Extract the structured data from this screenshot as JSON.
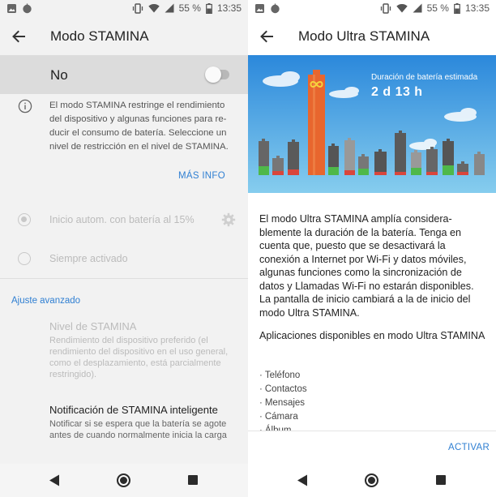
{
  "statusbar": {
    "battery": "55 %",
    "time": "13:35"
  },
  "left": {
    "title": "Modo STAMINA",
    "switch_label": "No",
    "switch_on": false,
    "description": "El modo STAMINA restringe el rendimiento del dispositivo y algunas funciones para re-ducir el consumo de batería. Seleccione un nivel de restricción en el nivel de STAMINA.",
    "more_info": "MÁS INFO",
    "options": [
      {
        "label": "Inicio autom. con batería al 15%",
        "selected": true
      },
      {
        "label": "Siempre activado",
        "selected": false
      }
    ],
    "advanced_header": "Ajuste avanzado",
    "stamina_level": {
      "title": "Nivel de STAMINA",
      "subtitle": "Rendimiento del dispositivo preferido (el rendimiento del dispositivo en el uso general, como el desplazamiento, está parcialmente restringido)."
    },
    "smart_notification": {
      "title": "Notificación de STAMINA inteligente",
      "subtitle": "Notificar si se espera que la batería se agote antes de cuando normalmente inicia la carga"
    }
  },
  "right": {
    "title": "Modo Ultra STAMINA",
    "battery_label": "Duración de batería estimada",
    "battery_value": "2 d 13 h",
    "description": "El modo Ultra STAMINA amplía considera-blemente la duración de la batería. Tenga en cuenta que, puesto que se desactivará la conexión a Internet por Wi-Fi y datos móviles, algunas funciones como la sincronización de datos y Llamadas Wi-Fi no estarán disponibles. La pantalla de inicio cambiará a la de inicio del modo Ultra STAMINA.",
    "apps_title": "Aplicaciones disponibles en modo Ultra STAMINA",
    "apps": [
      "Teléfono",
      "Contactos",
      "Mensajes",
      "Cámara",
      "Álbum"
    ],
    "activate": "ACTIVAR"
  },
  "colors": {
    "accent": "#2f7fd2",
    "hero_sky_top": "#2b88db",
    "hero_sky_bottom": "#7fc8ec",
    "battery_main": "#e8662e",
    "battery_green": "#4fb84a",
    "battery_red": "#d9463c"
  },
  "icons": [
    "image-icon",
    "bluetooth-icon",
    "vibrate-icon",
    "wifi-icon",
    "signal-icon",
    "battery-icon",
    "back-arrow-icon",
    "info-icon",
    "gear-icon",
    "infinity-icon",
    "nav-back-icon",
    "nav-home-icon",
    "nav-recents-icon"
  ]
}
